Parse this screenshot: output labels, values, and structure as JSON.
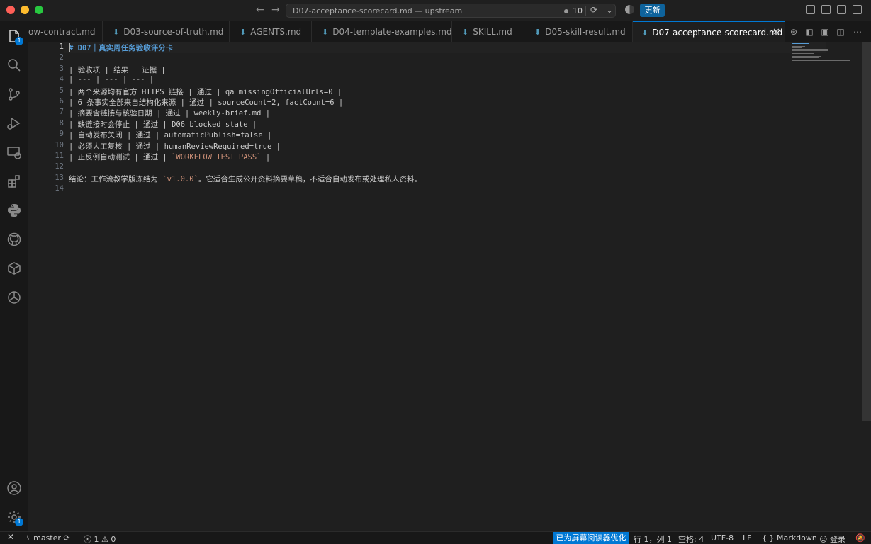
{
  "window": {
    "title": "D07-acceptance-scorecard.md — upstream",
    "change_count": "10",
    "update_label": "更新"
  },
  "activity_bar": {
    "explorer_badge": "1",
    "settings_badge": "1"
  },
  "tabs": [
    {
      "label": "ow-contract.md",
      "icon": false,
      "active": false
    },
    {
      "label": "D03-source-of-truth.md",
      "icon": true,
      "active": false
    },
    {
      "label": "AGENTS.md",
      "icon": true,
      "active": false
    },
    {
      "label": "D04-template-examples.md",
      "icon": true,
      "active": false
    },
    {
      "label": "SKILL.md",
      "icon": true,
      "active": false
    },
    {
      "label": "D05-skill-result.md",
      "icon": true,
      "active": false
    },
    {
      "label": "D07-acceptance-scorecard.md",
      "icon": true,
      "active": true
    }
  ],
  "editor": {
    "line_numbers": [
      "1",
      "2",
      "3",
      "4",
      "5",
      "6",
      "7",
      "8",
      "9",
      "10",
      "11",
      "12",
      "13",
      "14"
    ],
    "lines": [
      "# D07｜真实周任务验收评分卡",
      "",
      "| 验收项 | 结果 | 证据 |",
      "| --- | --- | --- |",
      "| 两个来源均有官方 HTTPS 链接 | 通过 | qa missingOfficialUrls=0 |",
      "| 6 条事实全部来自结构化来源 | 通过 | sourceCount=2, factCount=6 |",
      "| 摘要含链接与核验日期 | 通过 | weekly-brief.md |",
      "| 缺链接时会停止 | 通过 | D06 blocked state |",
      "| 自动发布关闭 | 通过 | automaticPublish=false |",
      "| 必须人工复核 | 通过 | humanReviewRequired=true |",
      "| 正反例自动测试 | 通过 | `WORKFLOW TEST PASS` |",
      "",
      "结论：工作流教学版冻结为 `v1.0.0`。它适合生成公开资料摘要草稿，不适合自动发布或处理私人资料。",
      ""
    ],
    "line11_prefix": "| 正反例自动测试 | 通过 | ",
    "line11_code": "`WORKFLOW TEST PASS`",
    "line11_suffix": " |",
    "line13_prefix": "结论：工作流教学版冻结为 ",
    "line13_code": "`v1.0.0`",
    "line13_suffix": "。它适合生成公开资料摘要草稿，不适合自动发布或处理私人资料。"
  },
  "statusbar": {
    "branch": "master",
    "errors": "1",
    "warnings": "0",
    "screen_reader": "已为屏幕阅读器优化",
    "position": "行 1，列 1",
    "spaces": "空格: 4",
    "encoding": "UTF-8",
    "eol": "LF",
    "language": "Markdown",
    "account": "登录"
  },
  "colors": {
    "accent": "#0078d4",
    "heading": "#569cd6",
    "inline_code": "#ce9178",
    "md_icon": "#519aba"
  }
}
